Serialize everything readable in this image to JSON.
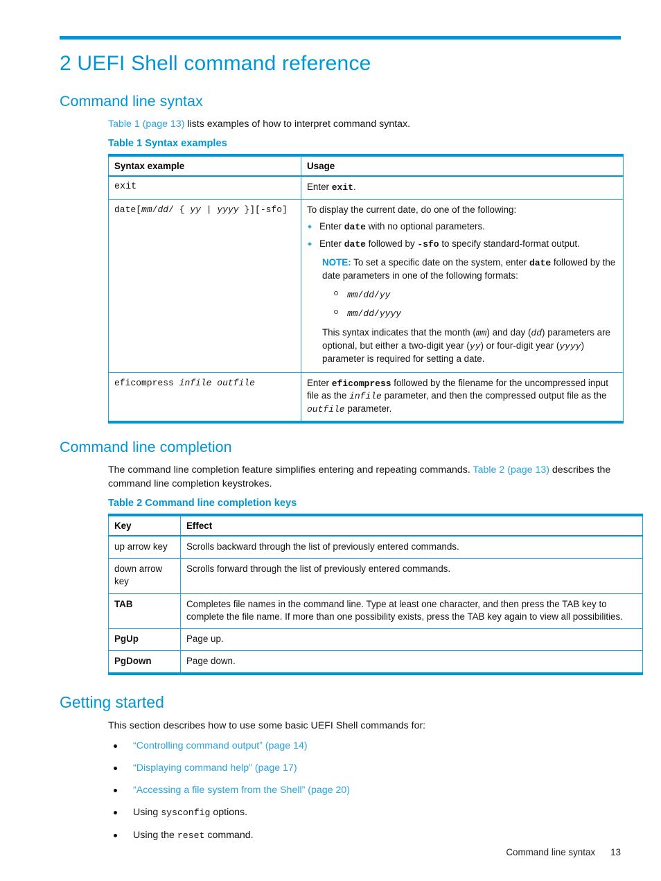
{
  "document": {
    "chapter_number": "2",
    "chapter_title": "2 UEFI Shell command reference",
    "accent_color": "#0096d6",
    "link_color": "#29a3dc"
  },
  "sections": {
    "command_line_syntax": {
      "heading": "Command line syntax",
      "intro_link": "Table 1 (page 13)",
      "intro_rest": " lists examples of how to interpret command syntax.",
      "table_caption": "Table 1 Syntax examples",
      "table": {
        "headers": [
          "Syntax example",
          "Usage"
        ],
        "rows": [
          {
            "syntax_plain": "exit",
            "usage_prefix": "Enter ",
            "usage_cmd": "exit",
            "usage_suffix": "."
          },
          {
            "syntax_parts": {
              "cmd": "date",
              "open_bracket": "[",
              "mm": "mm",
              "slash1": "/",
              "dd": "dd",
              "slash2": "/",
              "open_brace": "{",
              "yy": "yy",
              "pipe": "|",
              "yyyy": "yyyy",
              "close_brace": "}",
              "close_bracket": "]",
              "sfo_option": "[-sfo]"
            },
            "usage_lead": "To display the current date, do one of the following:",
            "bullets": [
              {
                "pre": "Enter ",
                "cmd": "date",
                "post": " with no optional parameters."
              },
              {
                "pre": "Enter ",
                "cmd": "date",
                "mid": " followed by ",
                "cmd2": "-sfo",
                "post": " to specify standard-format output."
              }
            ],
            "note": {
              "label": "NOTE:",
              "text_pre": "   To set a specific date on the system, enter ",
              "cmd": "date",
              "text_post": "  followed by the date parameters in one of the following formats:"
            },
            "formats": [
              {
                "mm": "mm",
                "s1": "/",
                "dd": "dd",
                "s2": "/",
                "yr": "yy"
              },
              {
                "mm": "mm",
                "s1": "/",
                "dd": "dd",
                "s2": "/",
                "yr": "yyyy"
              }
            ],
            "tail": {
              "p1": "This syntax indicates that the month (",
              "mm": "mm",
              "p2": ") and day (",
              "dd": "dd",
              "p3": ") parameters are optional, but either a two-digit year (",
              "yy": "yy",
              "p4": ") or four-digit year (",
              "yyyy": "yyyy",
              "p5": ") parameter is required for setting a date."
            }
          },
          {
            "syntax_cmd": "eficompress",
            "syntax_arg1": "infile",
            "syntax_arg2": "outfile",
            "usage": {
              "p1": "Enter ",
              "cmd": "eficompress",
              "p2": " followed by the filename for the uncompressed input file as the ",
              "arg1": "infile",
              "p3": " parameter, and then the compressed output file as the ",
              "arg2": "outfile",
              "p4": " parameter."
            }
          }
        ]
      }
    },
    "command_line_completion": {
      "heading": "Command line completion",
      "intro_text": "The command line completion feature simplifies entering and repeating commands. ",
      "intro_link": "Table 2 (page 13)",
      "intro_tail": " describes the command line completion keystrokes.",
      "table_caption": "Table 2 Command line completion keys",
      "table": {
        "headers": [
          "Key",
          "Effect"
        ],
        "rows": [
          {
            "key": "up arrow key",
            "key_bold": false,
            "effect": "Scrolls backward through the list of previously entered commands."
          },
          {
            "key": "down arrow key",
            "key_bold": false,
            "effect": "Scrolls forward through the list of previously entered commands."
          },
          {
            "key": "TAB",
            "key_bold": true,
            "effect": "Completes file names in the command line. Type at least one character, and then press the TAB key to complete the file name. If more than one possibility exists, press the TAB key again to view all possibilities."
          },
          {
            "key": "PgUp",
            "key_bold": true,
            "effect": "Page up."
          },
          {
            "key": "PgDown",
            "key_bold": true,
            "effect": "Page down."
          }
        ]
      }
    },
    "getting_started": {
      "heading": "Getting started",
      "intro": "This section describes how to use some basic UEFI Shell commands for:",
      "bullets": [
        {
          "type": "link",
          "text": "“Controlling command output” (page 14)"
        },
        {
          "type": "link",
          "text": "“Displaying command help” (page 17)"
        },
        {
          "type": "link",
          "text": "“Accessing a file system from the Shell” (page 20)"
        },
        {
          "type": "mixed",
          "pre": "Using ",
          "mono": "sysconfig",
          "post": " options."
        },
        {
          "type": "mixed",
          "pre": "Using the ",
          "mono": "reset",
          "post": " command."
        }
      ]
    }
  },
  "footer": {
    "title": "Command line syntax",
    "page_number": "13"
  }
}
